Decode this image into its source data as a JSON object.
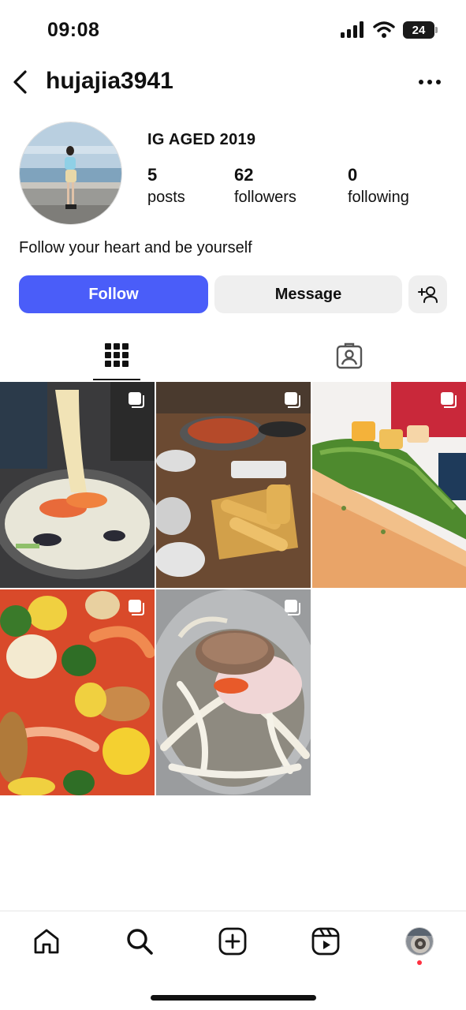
{
  "status_bar": {
    "time": "09:08",
    "battery": "24",
    "icons": [
      "signal-icon",
      "wifi-icon",
      "battery-icon"
    ]
  },
  "header": {
    "username": "hujajia3941",
    "back_icon": "chevron-left-icon",
    "more_icon": "more-horizontal-icon"
  },
  "profile": {
    "name": "IG AGED 2019",
    "stats": [
      {
        "value": "5",
        "label": "posts"
      },
      {
        "value": "62",
        "label": "followers"
      },
      {
        "value": "0",
        "label": "following"
      }
    ],
    "bio": "Follow your heart and be yourself"
  },
  "actions": {
    "follow_label": "Follow",
    "message_label": "Message",
    "add_user_icon": "add-person-icon"
  },
  "tabs": [
    {
      "icon": "grid-icon",
      "active": true
    },
    {
      "icon": "tagged-icon",
      "active": false
    }
  ],
  "posts": [
    {
      "subject": "seafood noodle soup",
      "multi": true
    },
    {
      "subject": "korean table with tempura",
      "multi": true
    },
    {
      "subject": "platter with sprouts and fruit",
      "multi": true
    },
    {
      "subject": "crab corn shrimp boil",
      "multi": true
    },
    {
      "subject": "grilled meat with radish",
      "multi": true
    }
  ],
  "bottom_nav": [
    {
      "icon": "home-icon"
    },
    {
      "icon": "search-icon"
    },
    {
      "icon": "create-icon"
    },
    {
      "icon": "reels-icon"
    },
    {
      "icon": "profile-avatar"
    }
  ],
  "colors": {
    "accent": "#4a5df9",
    "secondary_button": "#efefef",
    "notification_dot": "#ff3040"
  }
}
